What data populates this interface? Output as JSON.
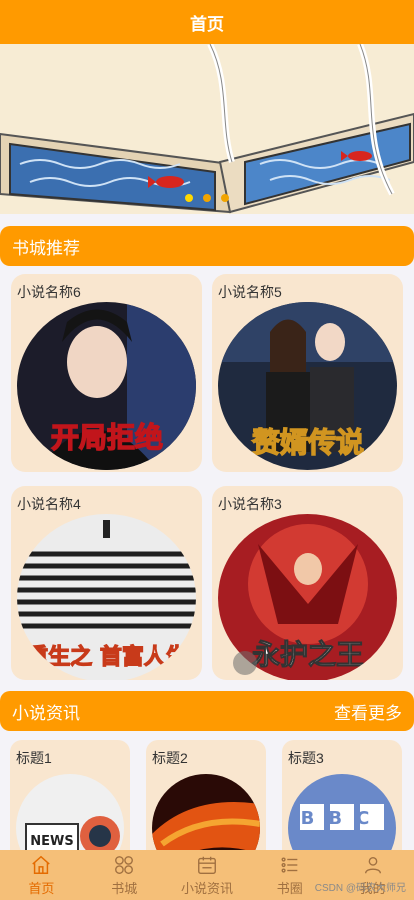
{
  "header": {
    "title": "首页"
  },
  "banner": {
    "dot_count": 3,
    "active_index": 0
  },
  "recommend": {
    "title": "书城推荐",
    "books": [
      {
        "name": "小说名称6",
        "cover_text": "开局拒绝"
      },
      {
        "name": "小说名称5",
        "cover_text": "赘婿传说"
      },
      {
        "name": "小说名称4",
        "cover_text": "重生之 首富人生"
      },
      {
        "name": "小说名称3",
        "cover_text": "永护之王"
      }
    ]
  },
  "news": {
    "title": "小说资讯",
    "more": "查看更多",
    "items": [
      {
        "title": "标题1",
        "img_text": "NEWS"
      },
      {
        "title": "标题2"
      },
      {
        "title": "标题3",
        "img_text": "BBC"
      }
    ]
  },
  "tabbar": {
    "items": [
      {
        "label": "首页",
        "icon": "home-icon",
        "active": true
      },
      {
        "label": "书城",
        "icon": "grid-icon"
      },
      {
        "label": "小说资讯",
        "icon": "calendar-icon"
      },
      {
        "label": "书圈",
        "icon": "list-icon"
      },
      {
        "label": "我的",
        "icon": "user-icon"
      }
    ]
  },
  "watermark": "CSDN @码农大师兄",
  "colors": {
    "accent": "#ff9a00",
    "card_bg": "#f9e6cf",
    "tabbar_bg": "#f5bf78"
  }
}
